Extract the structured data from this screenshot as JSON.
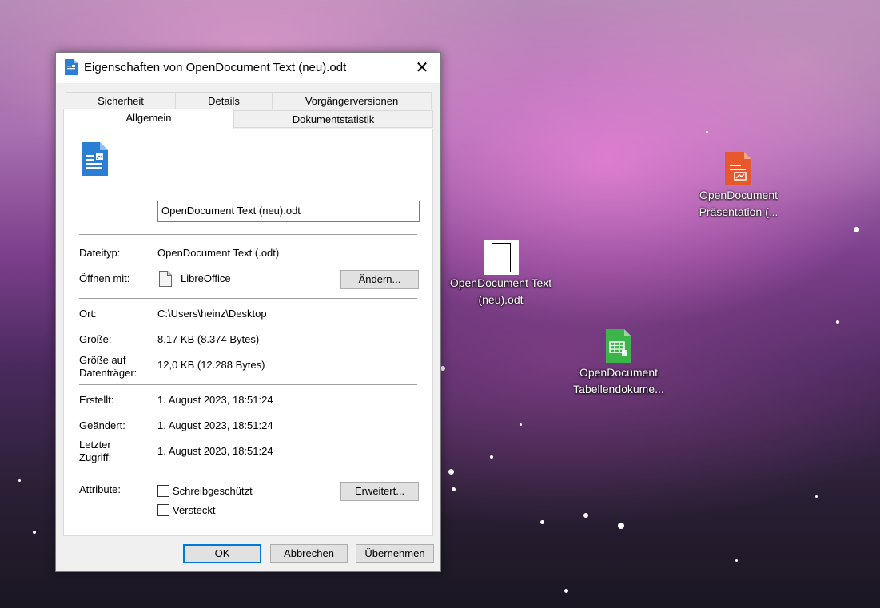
{
  "dialog": {
    "title": "Eigenschaften von OpenDocument Text (neu).odt",
    "close_glyph": "✕",
    "tabs_back": [
      "Sicherheit",
      "Details",
      "Vorgängerversionen"
    ],
    "tabs_front": [
      "Allgemein",
      "Dokumentstatistik"
    ],
    "active_tab": "Allgemein",
    "file_name_value": "OpenDocument Text (neu).odt",
    "rows": {
      "dateityp": {
        "label": "Dateityp:",
        "value": "OpenDocument Text (.odt)"
      },
      "oeffnen": {
        "label": "Öffnen mit:",
        "value": "LibreOffice",
        "button": "Ändern..."
      },
      "ort": {
        "label": "Ort:",
        "value": "C:\\Users\\heinz\\Desktop"
      },
      "groesse": {
        "label": "Größe:",
        "value": "8,17 KB (8.374 Bytes)"
      },
      "groesse_dt": {
        "label_1": "Größe auf",
        "label_2": "Datenträger:",
        "value": "12,0 KB (12.288 Bytes)"
      },
      "erstellt": {
        "label": "Erstellt:",
        "value": "1. August 2023, 18:51:24"
      },
      "geaendert": {
        "label": "Geändert:",
        "value": "1. August 2023, 18:51:24"
      },
      "zugriff": {
        "label_1": "Letzter",
        "label_2": "Zugriff:",
        "value": "1. August 2023, 18:51:24"
      },
      "attribute": {
        "label": "Attribute:",
        "readonly": {
          "label": "Schreibgeschützt",
          "checked": false
        },
        "hidden": {
          "label": "Versteckt",
          "checked": false
        },
        "button": "Erweitert..."
      }
    },
    "footer": {
      "ok": "OK",
      "cancel": "Abbrechen",
      "apply": "Übernehmen"
    }
  },
  "desktop": {
    "icons": [
      {
        "line1": "OpenDocument Text",
        "line2": "(neu).odt"
      },
      {
        "line1": "OpenDocument",
        "line2": "Präsentation (..."
      },
      {
        "line1": "OpenDocument",
        "line2": "Tabellendokume..."
      }
    ]
  },
  "colors": {
    "writer_blue": "#2a7fd4",
    "impress_orange": "#e8582d",
    "calc_green": "#3bb54a",
    "focus_blue": "#0078d7"
  }
}
